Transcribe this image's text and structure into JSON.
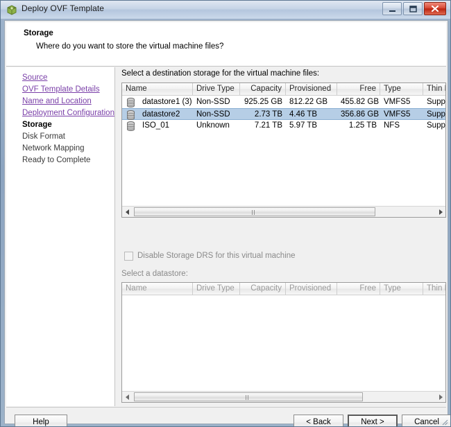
{
  "window": {
    "title": "Deploy OVF Template",
    "app_icon": "ovf-package-icon",
    "controls": {
      "minimize": "minimize-button",
      "maximize": "maximize-button",
      "close": "close-button"
    }
  },
  "header": {
    "title": "Storage",
    "subtitle": "Where do you want to store the virtual machine files?"
  },
  "sidebar": {
    "items": [
      {
        "label": "Source",
        "state": "link"
      },
      {
        "label": "OVF Template Details",
        "state": "link"
      },
      {
        "label": "Name and Location",
        "state": "link"
      },
      {
        "label": "Deployment Configuration",
        "state": "link"
      },
      {
        "label": "Storage",
        "state": "current"
      },
      {
        "label": "Disk Format",
        "state": "future"
      },
      {
        "label": "Network Mapping",
        "state": "future"
      },
      {
        "label": "Ready to Complete",
        "state": "future"
      }
    ]
  },
  "main": {
    "destination_label": "Select a destination storage for the virtual machine files:",
    "datastore_label": "Select a datastore:",
    "columns": [
      "Name",
      "Drive Type",
      "Capacity",
      "Provisioned",
      "Free",
      "Type",
      "Thin Provisioning"
    ],
    "columns_truncated": [
      "Name",
      "Drive Type",
      "Capacity",
      "Provisioned",
      "Free",
      "Type",
      "Thin Prov"
    ],
    "columns_truncated_bottom": [
      "Name",
      "Drive Type",
      "Capacity",
      "Provisioned",
      "Free",
      "Type",
      "Thin Provi"
    ],
    "rows": [
      {
        "icon": "datastore-icon",
        "name": "datastore1 (3)",
        "drive_type": "Non-SSD",
        "capacity": "925.25 GB",
        "provisioned": "812.22 GB",
        "free": "455.82 GB",
        "type": "VMFS5",
        "thin_provisioning": "Supporte",
        "selected": false
      },
      {
        "icon": "datastore-icon",
        "name": "datastore2",
        "drive_type": "Non-SSD",
        "capacity": "2.73 TB",
        "provisioned": "4.46 TB",
        "free": "356.86 GB",
        "type": "VMFS5",
        "thin_provisioning": "Supporte",
        "selected": true
      },
      {
        "icon": "datastore-icon",
        "name": "ISO_01",
        "drive_type": "Unknown",
        "capacity": "7.21 TB",
        "provisioned": "5.97 TB",
        "free": "1.25 TB",
        "type": "NFS",
        "thin_provisioning": "Supporte",
        "selected": false
      }
    ],
    "bottom_rows": [],
    "disable_drs": {
      "label": "Disable Storage DRS for this virtual machine",
      "checked": false,
      "enabled": false
    }
  },
  "footer": {
    "help": "Help",
    "back": "< Back",
    "next": "Next >",
    "cancel": "Cancel"
  },
  "colors": {
    "selection": "#b6cee6",
    "link": "#7a3fa8",
    "close_button": "#ba2410",
    "dialog_bg": "#f0f0f0"
  }
}
